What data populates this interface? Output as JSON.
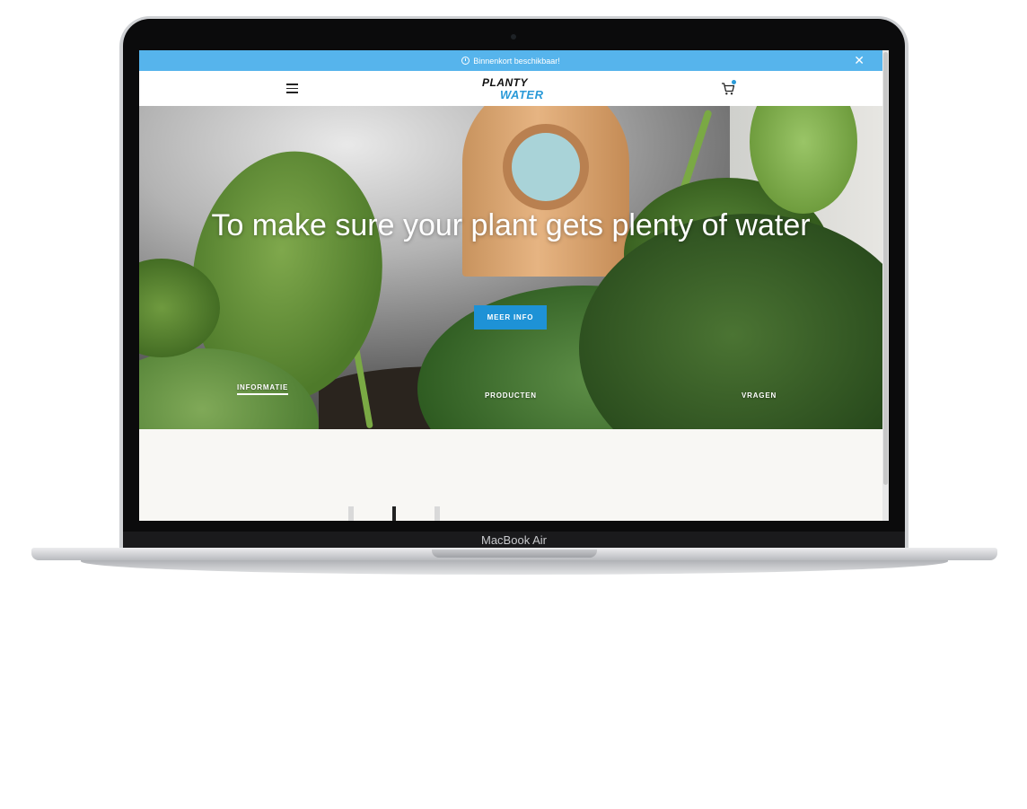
{
  "device": {
    "label": "MacBook Air"
  },
  "site": {
    "announcement": {
      "text": "Binnenkort beschikbaar!",
      "close_icon": "close-icon",
      "clock_icon": "clock-icon"
    },
    "header": {
      "menu_icon": "hamburger-menu-icon",
      "logo": {
        "line1": "PLANTY",
        "line2": "WATER",
        "colors": {
          "line1": "#111111",
          "line2": "#2a9ad8"
        }
      },
      "cart_icon": "shopping-cart-icon"
    },
    "hero": {
      "title": "To make sure your plant gets plenty of water",
      "button_label": "MEER INFO",
      "tabs": [
        {
          "label": "INFORMATIE",
          "active": true
        },
        {
          "label": "PRODUCTEN",
          "active": false
        },
        {
          "label": "VRAGEN",
          "active": false
        }
      ]
    },
    "colors": {
      "announcement_bar": "#56b4ec",
      "accent_button": "#1e92d6"
    }
  }
}
